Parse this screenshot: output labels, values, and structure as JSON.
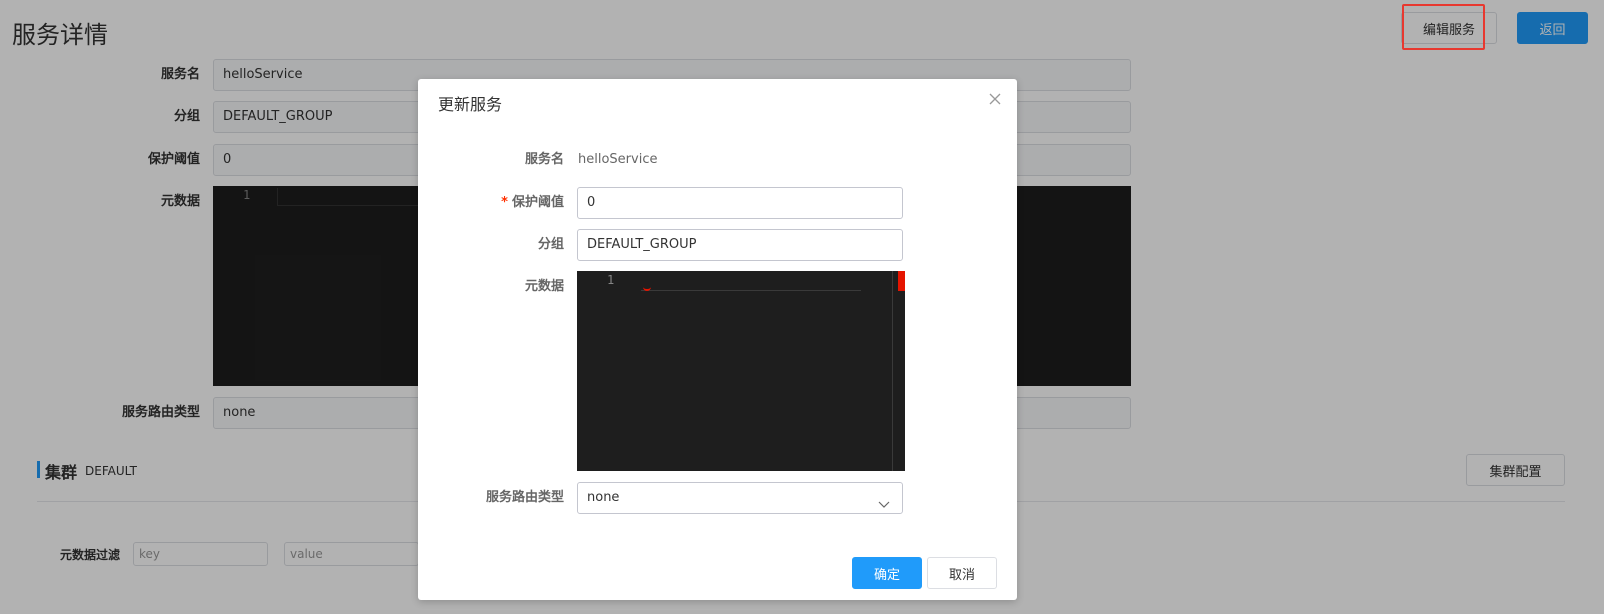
{
  "page": {
    "title": "服务详情",
    "edit_button": "编辑服务",
    "back_button": "返回",
    "fields": {
      "service_name": {
        "label": "服务名",
        "value": "helloService"
      },
      "group": {
        "label": "分组",
        "value": "DEFAULT_GROUP"
      },
      "protect_threshold": {
        "label": "保护阈值",
        "value": "0"
      },
      "metadata": {
        "label": "元数据",
        "line_number": "1"
      },
      "selector_type": {
        "label": "服务路由类型",
        "value": "none"
      }
    },
    "cluster": {
      "title": "集群",
      "name": "DEFAULT",
      "config_button": "集群配置"
    },
    "filter": {
      "label": "元数据过滤",
      "key_placeholder": "key",
      "value_placeholder": "value"
    }
  },
  "dialog": {
    "title": "更新服务",
    "service_name": {
      "label": "服务名",
      "value": "helloService"
    },
    "protect_threshold": {
      "label": "保护阈值",
      "required_mark": "*",
      "value": "0"
    },
    "group": {
      "label": "分组",
      "value": "DEFAULT_GROUP"
    },
    "metadata": {
      "label": "元数据",
      "line_number": "1"
    },
    "selector_type": {
      "label": "服务路由类型",
      "value": "none"
    },
    "ok_button": "确定",
    "cancel_button": "取消"
  },
  "colors": {
    "primary": "#209bfa",
    "highlight": "#e8382f",
    "editor_bg": "#1e1e1e",
    "required": "#ff3000"
  },
  "icons": {
    "close": "close-icon",
    "chevron": "chevron-down-icon"
  }
}
